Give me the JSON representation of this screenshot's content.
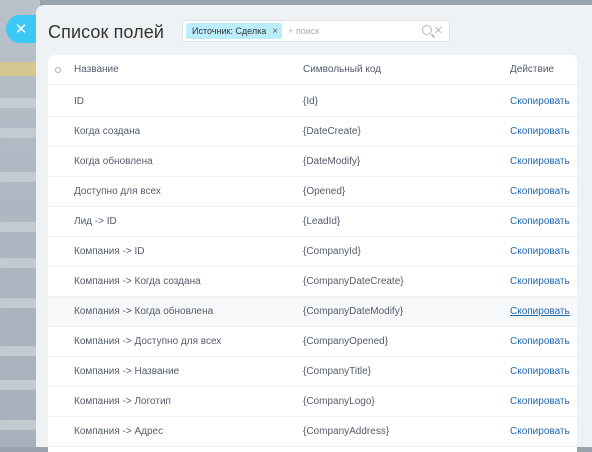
{
  "panel": {
    "title": "Список полей",
    "filter": {
      "chip_label": "Источник: Сделка",
      "add_placeholder": "+ поиск"
    }
  },
  "grid": {
    "columns": {
      "name": "Название",
      "code": "Символьный код",
      "action": "Действие"
    },
    "rows": [
      {
        "name": "ID",
        "code": "{Id}",
        "action": "Скопировать"
      },
      {
        "name": "Когда создана",
        "code": "{DateCreate}",
        "action": "Скопировать"
      },
      {
        "name": "Когда обновлена",
        "code": "{DateModify}",
        "action": "Скопировать"
      },
      {
        "name": "Доступно для всех",
        "code": "{Opened}",
        "action": "Скопировать"
      },
      {
        "name": "Лид -> ID",
        "code": "{LeadId}",
        "action": "Скопировать"
      },
      {
        "name": "Компания -> ID",
        "code": "{CompanyId}",
        "action": "Скопировать"
      },
      {
        "name": "Компания -> Когда создана",
        "code": "{CompanyDateCreate}",
        "action": "Скопировать"
      },
      {
        "name": "Компания -> Когда обновлена",
        "code": "{CompanyDateModify}",
        "action": "Скопировать"
      },
      {
        "name": "Компания -> Доступно для всех",
        "code": "{CompanyOpened}",
        "action": "Скопировать"
      },
      {
        "name": "Компания -> Название",
        "code": "{CompanyTitle}",
        "action": "Скопировать"
      },
      {
        "name": "Компания -> Логотип",
        "code": "{CompanyLogo}",
        "action": "Скопировать"
      },
      {
        "name": "Компания -> Адрес",
        "code": "{CompanyAddress}",
        "action": "Скопировать"
      }
    ]
  },
  "colors": {
    "accent": "#3bc8f5",
    "chip": "#bcedfc",
    "link": "#2067b0"
  },
  "icons": [
    "close-icon",
    "chip-remove-icon",
    "search-icon",
    "clear-icon",
    "settings-gear-icon"
  ]
}
